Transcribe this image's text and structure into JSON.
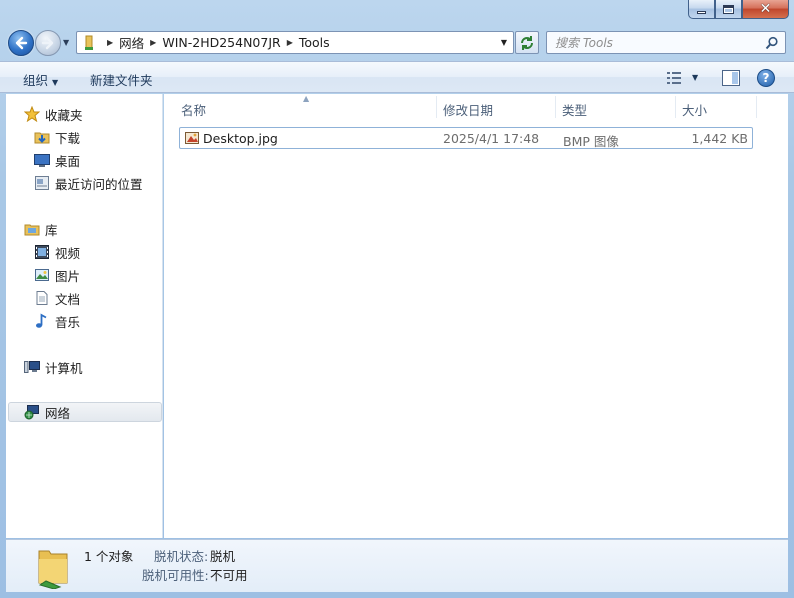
{
  "window": {
    "caption_close_glyph": "✕"
  },
  "address": {
    "crumbs": [
      "网络",
      "WIN-2HD254N07JR",
      "Tools"
    ]
  },
  "search": {
    "placeholder": "搜索 Tools"
  },
  "toolbar": {
    "organize_label": "组织",
    "new_folder_label": "新建文件夹",
    "help_glyph": "?"
  },
  "sidebar": {
    "favorites": {
      "label": "收藏夹",
      "items": [
        {
          "label": "下载",
          "icon": "download-folder-icon"
        },
        {
          "label": "桌面",
          "icon": "desktop-icon"
        },
        {
          "label": "最近访问的位置",
          "icon": "recent-places-icon"
        }
      ]
    },
    "libraries": {
      "label": "库",
      "items": [
        {
          "label": "视频",
          "icon": "video-library-icon"
        },
        {
          "label": "图片",
          "icon": "pictures-library-icon"
        },
        {
          "label": "文档",
          "icon": "documents-library-icon"
        },
        {
          "label": "音乐",
          "icon": "music-library-icon"
        }
      ]
    },
    "computer": {
      "label": "计算机"
    },
    "network": {
      "label": "网络",
      "selected": true
    }
  },
  "columns": {
    "name": "名称",
    "date": "修改日期",
    "type": "类型",
    "size": "大小"
  },
  "files": [
    {
      "name": "Desktop.jpg",
      "date": "2025/4/1 17:48",
      "type": "BMP 图像",
      "size": "1,442 KB"
    }
  ],
  "details": {
    "count": "1 个对象",
    "offline_status_label": "脱机状态:",
    "offline_status_value": "脱机",
    "offline_avail_label": "脱机可用性:",
    "offline_avail_value": "不可用"
  },
  "colors": {
    "frame": "#a9c8e6",
    "accent": "#2f72c7",
    "close": "#c0462c"
  }
}
